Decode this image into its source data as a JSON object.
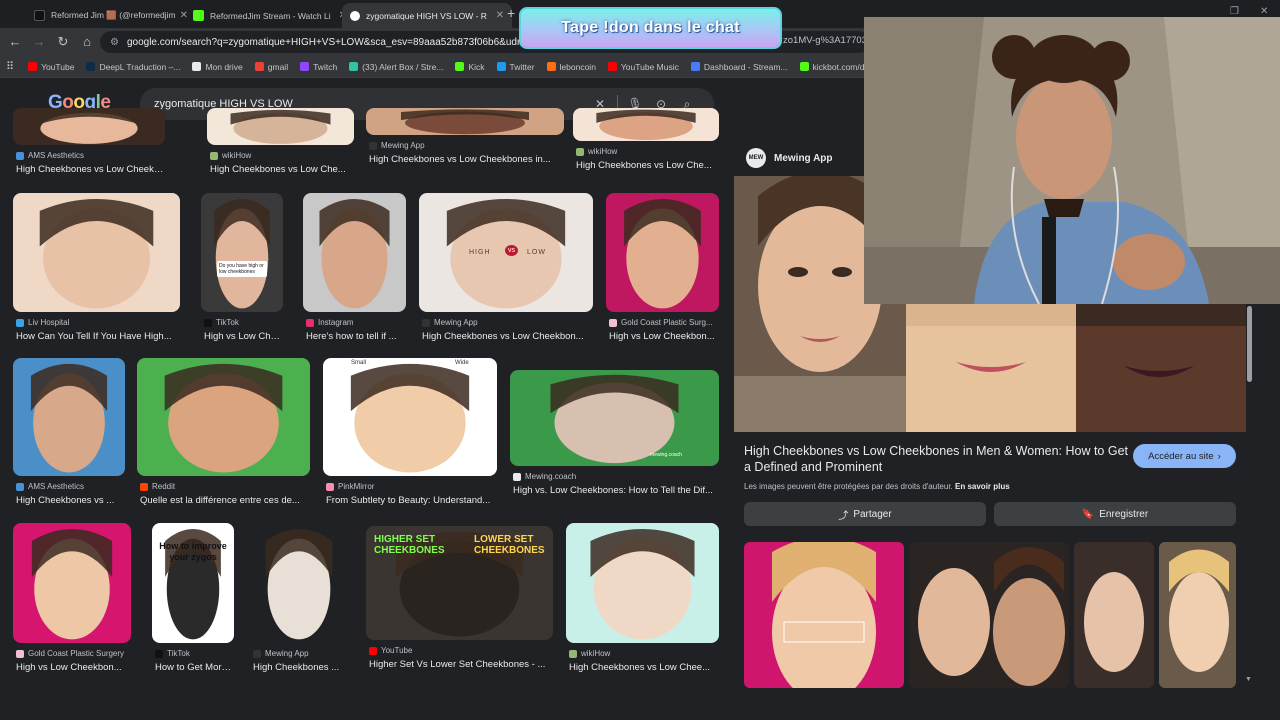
{
  "browser": {
    "tabs": [
      {
        "label": "Reformed Jim 🟫 (@reformedjim)",
        "fav": "#111111",
        "active": false
      },
      {
        "label": "ReformedJim Stream - Watch Li",
        "fav": "#53fc18",
        "active": false
      },
      {
        "label": "zygomatique HIGH VS LOW - R",
        "fav": "#8ab4f8",
        "active": true
      }
    ],
    "new_tab": "+",
    "omnibox_url": "google.com/search?q=zygomatique+HIGH+VS+LOW&sca_esv=89aaa52b873f06b6&udm=2&b",
    "omnibox_url_tail": "zo1MV-g%3A17703",
    "bookmarks": [
      {
        "label": "YouTube",
        "color": "#ff0000"
      },
      {
        "label": "DeepL Traduction –...",
        "color": "#0f2b46"
      },
      {
        "label": "Mon drive",
        "color": "#e8eaed"
      },
      {
        "label": "gmail",
        "color": "#ea4335"
      },
      {
        "label": "Twitch",
        "color": "#9146ff"
      },
      {
        "label": "(33) Alert Box / Stre...",
        "color": "#31c3a2"
      },
      {
        "label": "Kick",
        "color": "#53fc18"
      },
      {
        "label": "Twitter",
        "color": "#1d9bf0"
      },
      {
        "label": "leboncoin",
        "color": "#ff6e14"
      },
      {
        "label": "YouTube Music",
        "color": "#ff0000"
      },
      {
        "label": "Dashboard - Stream...",
        "color": "#4a7cf7"
      },
      {
        "label": "kickbot.com/dash",
        "color": "#53fc18"
      }
    ]
  },
  "google": {
    "logo": [
      "G",
      "o",
      "o",
      "g",
      "l",
      "e"
    ],
    "query": "zygomatique HIGH VS LOW",
    "results": [
      {
        "src": "AMS Aesthetics",
        "cap": "High Cheekbones vs Low Cheekbones...",
        "fav": "#4a90d9"
      },
      {
        "src": "wikiHow",
        "cap": "High Cheekbones vs Low Che...",
        "fav": "#93b874"
      },
      {
        "src": "Mewing App",
        "cap": "High Cheekbones vs Low Cheekbones in...",
        "fav": "#333333"
      },
      {
        "src": "wikiHow",
        "cap": "High Cheekbones vs Low Che...",
        "fav": "#93b874"
      },
      {
        "src": "Liv Hospital",
        "cap": "How Can You Tell If You Have High...",
        "fav": "#3aa3e3"
      },
      {
        "src": "TikTok",
        "cap": "High vs Low Chee...",
        "fav": "#111111"
      },
      {
        "src": "Instagram",
        "cap": "Here's how to tell if ...",
        "fav": "#e1306c"
      },
      {
        "src": "Mewing App",
        "cap": "High Cheekbones vs Low Cheekbon...",
        "fav": "#333333"
      },
      {
        "src": "Gold Coast Plastic Surg...",
        "cap": "High vs Low Cheekbon...",
        "fav": "#f2c1d1"
      },
      {
        "src": "AMS Aesthetics",
        "cap": "High Cheekbones vs ...",
        "fav": "#4a90d9"
      },
      {
        "src": "Reddit",
        "cap": "Quelle est la différence entre ces de...",
        "fav": "#ff4500"
      },
      {
        "src": "PinkMirror",
        "cap": "From Subtlety to Beauty: Understand...",
        "fav": "#f48fb1"
      },
      {
        "src": "Mewing.coach",
        "cap": "High vs. Low Cheekbones: How to Tell the Dif...",
        "fav": "#e8eaed"
      },
      {
        "src": "Gold Coast Plastic Surgery",
        "cap": "High vs Low Cheekbon...",
        "fav": "#f2c1d1"
      },
      {
        "src": "TikTok",
        "cap": "How to Get More P...",
        "fav": "#111111"
      },
      {
        "src": "Mewing App",
        "cap": "High Cheekbones ...",
        "fav": "#333333"
      },
      {
        "src": "YouTube",
        "cap": "Higher Set Vs Lower Set Cheekbones - ...",
        "fav": "#ff0000"
      },
      {
        "src": "wikiHow",
        "cap": "High Cheekbones vs Low Chee...",
        "fav": "#93b874"
      }
    ],
    "thumb_text": {
      "tiktok_bubble": "Do you have high or low cheekbones",
      "high_vs_low": [
        "HIGH",
        "vs",
        "LOW"
      ],
      "pinkmirror_labels": [
        "Small",
        "Wide"
      ],
      "zygos_title": "How to improve your zygos",
      "cheekbones_high": "HIGHER SET CHEEKBONES",
      "cheekbones_low": "LOWER SET CHEEKBONES",
      "mewing_coach": "mewing.coach"
    }
  },
  "panel": {
    "source": "Mewing App",
    "source_logo": "MEW",
    "title": "High Cheekbones vs Low Cheekbones in Men & Women: How to Get a Defined and Prominent",
    "visit_label": "Accéder au site",
    "copyright_text": "Les images peuvent être protégées par des droits d'auteur.",
    "copyright_link": "En savoir plus",
    "share_label": "Partager",
    "save_label": "Enregistrer"
  },
  "overlay": {
    "banner_text": "Tape !don dans le chat"
  }
}
